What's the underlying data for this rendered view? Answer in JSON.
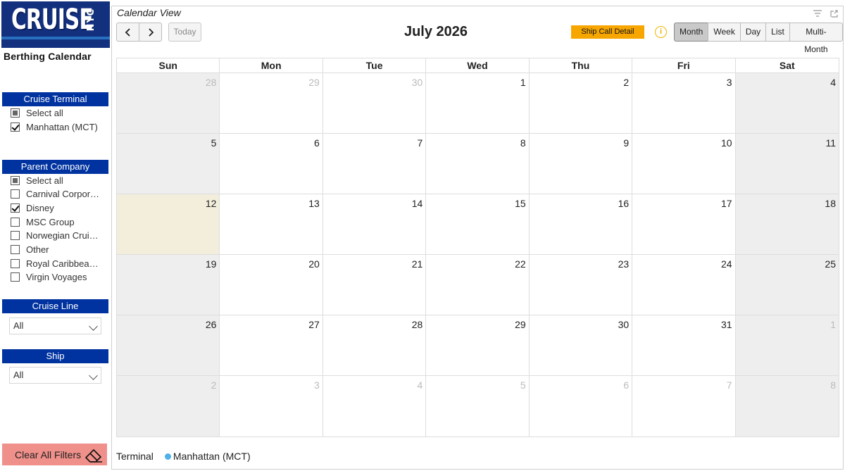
{
  "logo": {
    "main": "CRUISE",
    "sub": "NYC"
  },
  "app_title": "Berthing Calendar",
  "filters": {
    "terminal": {
      "header": "Cruise Terminal",
      "items": [
        {
          "label": "Select all",
          "state": "partial"
        },
        {
          "label": "Manhattan (MCT)",
          "state": "checked"
        }
      ]
    },
    "parent_company": {
      "header": "Parent Company",
      "items": [
        {
          "label": "Select all",
          "state": "partial"
        },
        {
          "label": "Carnival Corpor…",
          "state": "unchecked"
        },
        {
          "label": "Disney",
          "state": "checked"
        },
        {
          "label": "MSC Group",
          "state": "unchecked"
        },
        {
          "label": "Norwegian Crui…",
          "state": "unchecked"
        },
        {
          "label": "Other",
          "state": "unchecked"
        },
        {
          "label": "Royal Caribbea…",
          "state": "unchecked"
        },
        {
          "label": "Virgin Voyages",
          "state": "unchecked"
        }
      ]
    },
    "cruise_line": {
      "header": "Cruise Line",
      "value": "All"
    },
    "ship": {
      "header": "Ship",
      "value": "All"
    }
  },
  "clear_filters_label": "Clear All Filters",
  "panel": {
    "title": "Calendar View",
    "today_label": "Today",
    "month_title": "July 2026",
    "ship_call_label": "Ship Call Detail",
    "info_label": "i",
    "views": [
      "Month",
      "Week",
      "Day",
      "List",
      "Multi-Month"
    ],
    "active_view": "Month"
  },
  "calendar": {
    "weekdays": [
      "Sun",
      "Mon",
      "Tue",
      "Wed",
      "Thu",
      "Fri",
      "Sat"
    ],
    "days": [
      {
        "n": "28",
        "other": true
      },
      {
        "n": "29",
        "other": true
      },
      {
        "n": "30",
        "other": true
      },
      {
        "n": "1"
      },
      {
        "n": "2"
      },
      {
        "n": "3"
      },
      {
        "n": "4"
      },
      {
        "n": "5"
      },
      {
        "n": "6"
      },
      {
        "n": "7"
      },
      {
        "n": "8"
      },
      {
        "n": "9"
      },
      {
        "n": "10"
      },
      {
        "n": "11"
      },
      {
        "n": "12",
        "today": true
      },
      {
        "n": "13"
      },
      {
        "n": "14"
      },
      {
        "n": "15"
      },
      {
        "n": "16"
      },
      {
        "n": "17"
      },
      {
        "n": "18"
      },
      {
        "n": "19"
      },
      {
        "n": "20"
      },
      {
        "n": "21"
      },
      {
        "n": "22"
      },
      {
        "n": "23"
      },
      {
        "n": "24"
      },
      {
        "n": "25"
      },
      {
        "n": "26"
      },
      {
        "n": "27"
      },
      {
        "n": "28"
      },
      {
        "n": "29"
      },
      {
        "n": "30"
      },
      {
        "n": "31"
      },
      {
        "n": "1",
        "other": true
      },
      {
        "n": "2",
        "other": true
      },
      {
        "n": "3",
        "other": true
      },
      {
        "n": "4",
        "other": true
      },
      {
        "n": "5",
        "other": true
      },
      {
        "n": "6",
        "other": true
      },
      {
        "n": "7",
        "other": true
      },
      {
        "n": "8",
        "other": true
      }
    ]
  },
  "legend": {
    "title": "Terminal",
    "items": [
      {
        "label": "Manhattan (MCT)",
        "color": "#4fb0ea"
      }
    ]
  },
  "colors": {
    "filter_header": "#0033a0",
    "ship_call": "#f7a600",
    "today_bg": "#f2eedb",
    "clear_button": "#f0908a"
  }
}
